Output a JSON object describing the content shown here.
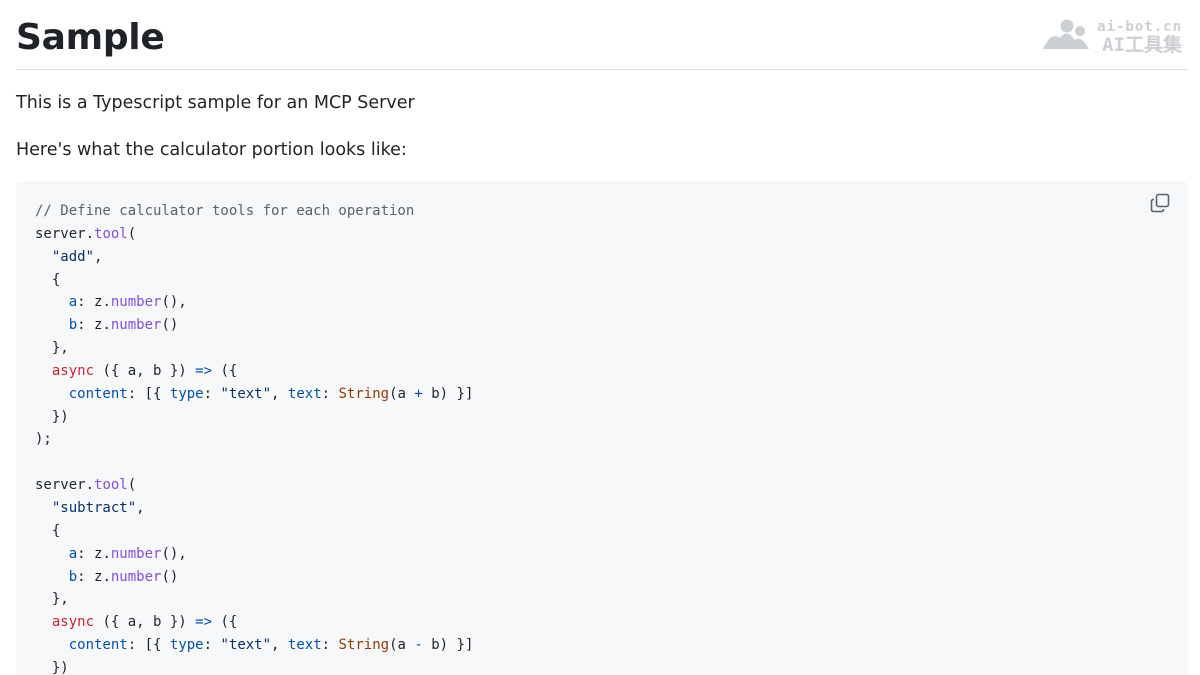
{
  "page": {
    "title": "Sample",
    "watermark": {
      "url": "ai-bot.cn",
      "name": "AI工具集"
    },
    "intro": "This is a Typescript sample for an MCP Server",
    "lead": "Here's what the calculator portion looks like:"
  },
  "code_block": {
    "copy_icon": "copy-icon",
    "language": "typescript",
    "lines": [
      [
        {
          "t": "comment",
          "v": "// Define calculator tools for each operation"
        }
      ],
      [
        {
          "t": "plain",
          "v": "server."
        },
        {
          "t": "func",
          "v": "tool"
        },
        {
          "t": "plain",
          "v": "("
        }
      ],
      [
        {
          "t": "plain",
          "v": "  "
        },
        {
          "t": "string",
          "v": "\"add\""
        },
        {
          "t": "plain",
          "v": ","
        }
      ],
      [
        {
          "t": "plain",
          "v": "  {"
        }
      ],
      [
        {
          "t": "plain",
          "v": "    "
        },
        {
          "t": "prop",
          "v": "a"
        },
        {
          "t": "plain",
          "v": ": z."
        },
        {
          "t": "func",
          "v": "number"
        },
        {
          "t": "plain",
          "v": "(),"
        }
      ],
      [
        {
          "t": "plain",
          "v": "    "
        },
        {
          "t": "prop",
          "v": "b"
        },
        {
          "t": "plain",
          "v": ": z."
        },
        {
          "t": "func",
          "v": "number"
        },
        {
          "t": "plain",
          "v": "()"
        }
      ],
      [
        {
          "t": "plain",
          "v": "  },"
        }
      ],
      [
        {
          "t": "plain",
          "v": "  "
        },
        {
          "t": "keyword",
          "v": "async"
        },
        {
          "t": "plain",
          "v": " ({ a, b }) "
        },
        {
          "t": "op",
          "v": "=>"
        },
        {
          "t": "plain",
          "v": " ({"
        }
      ],
      [
        {
          "t": "plain",
          "v": "    "
        },
        {
          "t": "prop",
          "v": "content"
        },
        {
          "t": "plain",
          "v": ": [{ "
        },
        {
          "t": "prop",
          "v": "type"
        },
        {
          "t": "plain",
          "v": ": "
        },
        {
          "t": "string",
          "v": "\"text\""
        },
        {
          "t": "plain",
          "v": ", "
        },
        {
          "t": "prop",
          "v": "text"
        },
        {
          "t": "plain",
          "v": ": "
        },
        {
          "t": "builtin",
          "v": "String"
        },
        {
          "t": "plain",
          "v": "(a "
        },
        {
          "t": "op",
          "v": "+"
        },
        {
          "t": "plain",
          "v": " b) }]"
        }
      ],
      [
        {
          "t": "plain",
          "v": "  })"
        }
      ],
      [
        {
          "t": "plain",
          "v": ");"
        }
      ],
      [
        {
          "t": "plain",
          "v": ""
        }
      ],
      [
        {
          "t": "plain",
          "v": "server."
        },
        {
          "t": "func",
          "v": "tool"
        },
        {
          "t": "plain",
          "v": "("
        }
      ],
      [
        {
          "t": "plain",
          "v": "  "
        },
        {
          "t": "string",
          "v": "\"subtract\""
        },
        {
          "t": "plain",
          "v": ","
        }
      ],
      [
        {
          "t": "plain",
          "v": "  {"
        }
      ],
      [
        {
          "t": "plain",
          "v": "    "
        },
        {
          "t": "prop",
          "v": "a"
        },
        {
          "t": "plain",
          "v": ": z."
        },
        {
          "t": "func",
          "v": "number"
        },
        {
          "t": "plain",
          "v": "(),"
        }
      ],
      [
        {
          "t": "plain",
          "v": "    "
        },
        {
          "t": "prop",
          "v": "b"
        },
        {
          "t": "plain",
          "v": ": z."
        },
        {
          "t": "func",
          "v": "number"
        },
        {
          "t": "plain",
          "v": "()"
        }
      ],
      [
        {
          "t": "plain",
          "v": "  },"
        }
      ],
      [
        {
          "t": "plain",
          "v": "  "
        },
        {
          "t": "keyword",
          "v": "async"
        },
        {
          "t": "plain",
          "v": " ({ a, b }) "
        },
        {
          "t": "op",
          "v": "=>"
        },
        {
          "t": "plain",
          "v": " ({"
        }
      ],
      [
        {
          "t": "plain",
          "v": "    "
        },
        {
          "t": "prop",
          "v": "content"
        },
        {
          "t": "plain",
          "v": ": [{ "
        },
        {
          "t": "prop",
          "v": "type"
        },
        {
          "t": "plain",
          "v": ": "
        },
        {
          "t": "string",
          "v": "\"text\""
        },
        {
          "t": "plain",
          "v": ", "
        },
        {
          "t": "prop",
          "v": "text"
        },
        {
          "t": "plain",
          "v": ": "
        },
        {
          "t": "builtin",
          "v": "String"
        },
        {
          "t": "plain",
          "v": "(a "
        },
        {
          "t": "op",
          "v": "-"
        },
        {
          "t": "plain",
          "v": " b) }]"
        }
      ],
      [
        {
          "t": "plain",
          "v": "  })"
        }
      ]
    ]
  },
  "colors": {
    "code_background": "#f6f8fa",
    "comment": "#59636e",
    "function": "#8250df",
    "string": "#0a3069",
    "property": "#0550ae",
    "keyword": "#cf222e",
    "builtin": "#953800"
  }
}
